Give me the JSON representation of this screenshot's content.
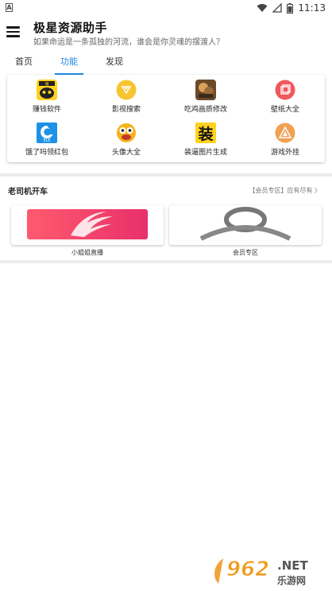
{
  "status_bar": {
    "left_badge": "A",
    "time": "11:13",
    "icons": [
      "wifi-icon",
      "signal-icon",
      "battery-icon"
    ]
  },
  "header": {
    "title": "极星资源助手",
    "subtitle": "如果命运是一条孤独的河流，谁会是你灵魂的摆渡人？"
  },
  "tabs": [
    {
      "label": "首页",
      "active": false
    },
    {
      "label": "功能",
      "active": true
    },
    {
      "label": "发现",
      "active": false
    }
  ],
  "functions": [
    {
      "label": "赚钱软件",
      "icon": "cat-money-icon"
    },
    {
      "label": "影视搜索",
      "icon": "video-search-icon"
    },
    {
      "label": "吃鸡画质修改",
      "icon": "game-quality-icon"
    },
    {
      "label": "壁纸大全",
      "icon": "wallpaper-icon"
    },
    {
      "label": "饿了吗领红包",
      "icon": "eleme-icon"
    },
    {
      "label": "头像大全",
      "icon": "avatar-emoji-icon"
    },
    {
      "label": "装逼图片生成",
      "icon": "zhuang-icon"
    },
    {
      "label": "游戏外挂",
      "icon": "game-plugin-icon"
    }
  ],
  "section": {
    "title": "老司机开车",
    "more": "【会员专区】应有尽有 〉"
  },
  "media_cards": [
    {
      "label": "小姐姐直播",
      "icon": "live-stream-banner"
    },
    {
      "label": "会员专区",
      "icon": "member-placeholder-icon"
    }
  ],
  "watermark": {
    "num": "962",
    "net": ".NET",
    "sub": "乐游网"
  },
  "colors": {
    "accent": "#1e88e5",
    "live_gradient_start": "#ff5a6e",
    "live_gradient_end": "#e8306a"
  }
}
